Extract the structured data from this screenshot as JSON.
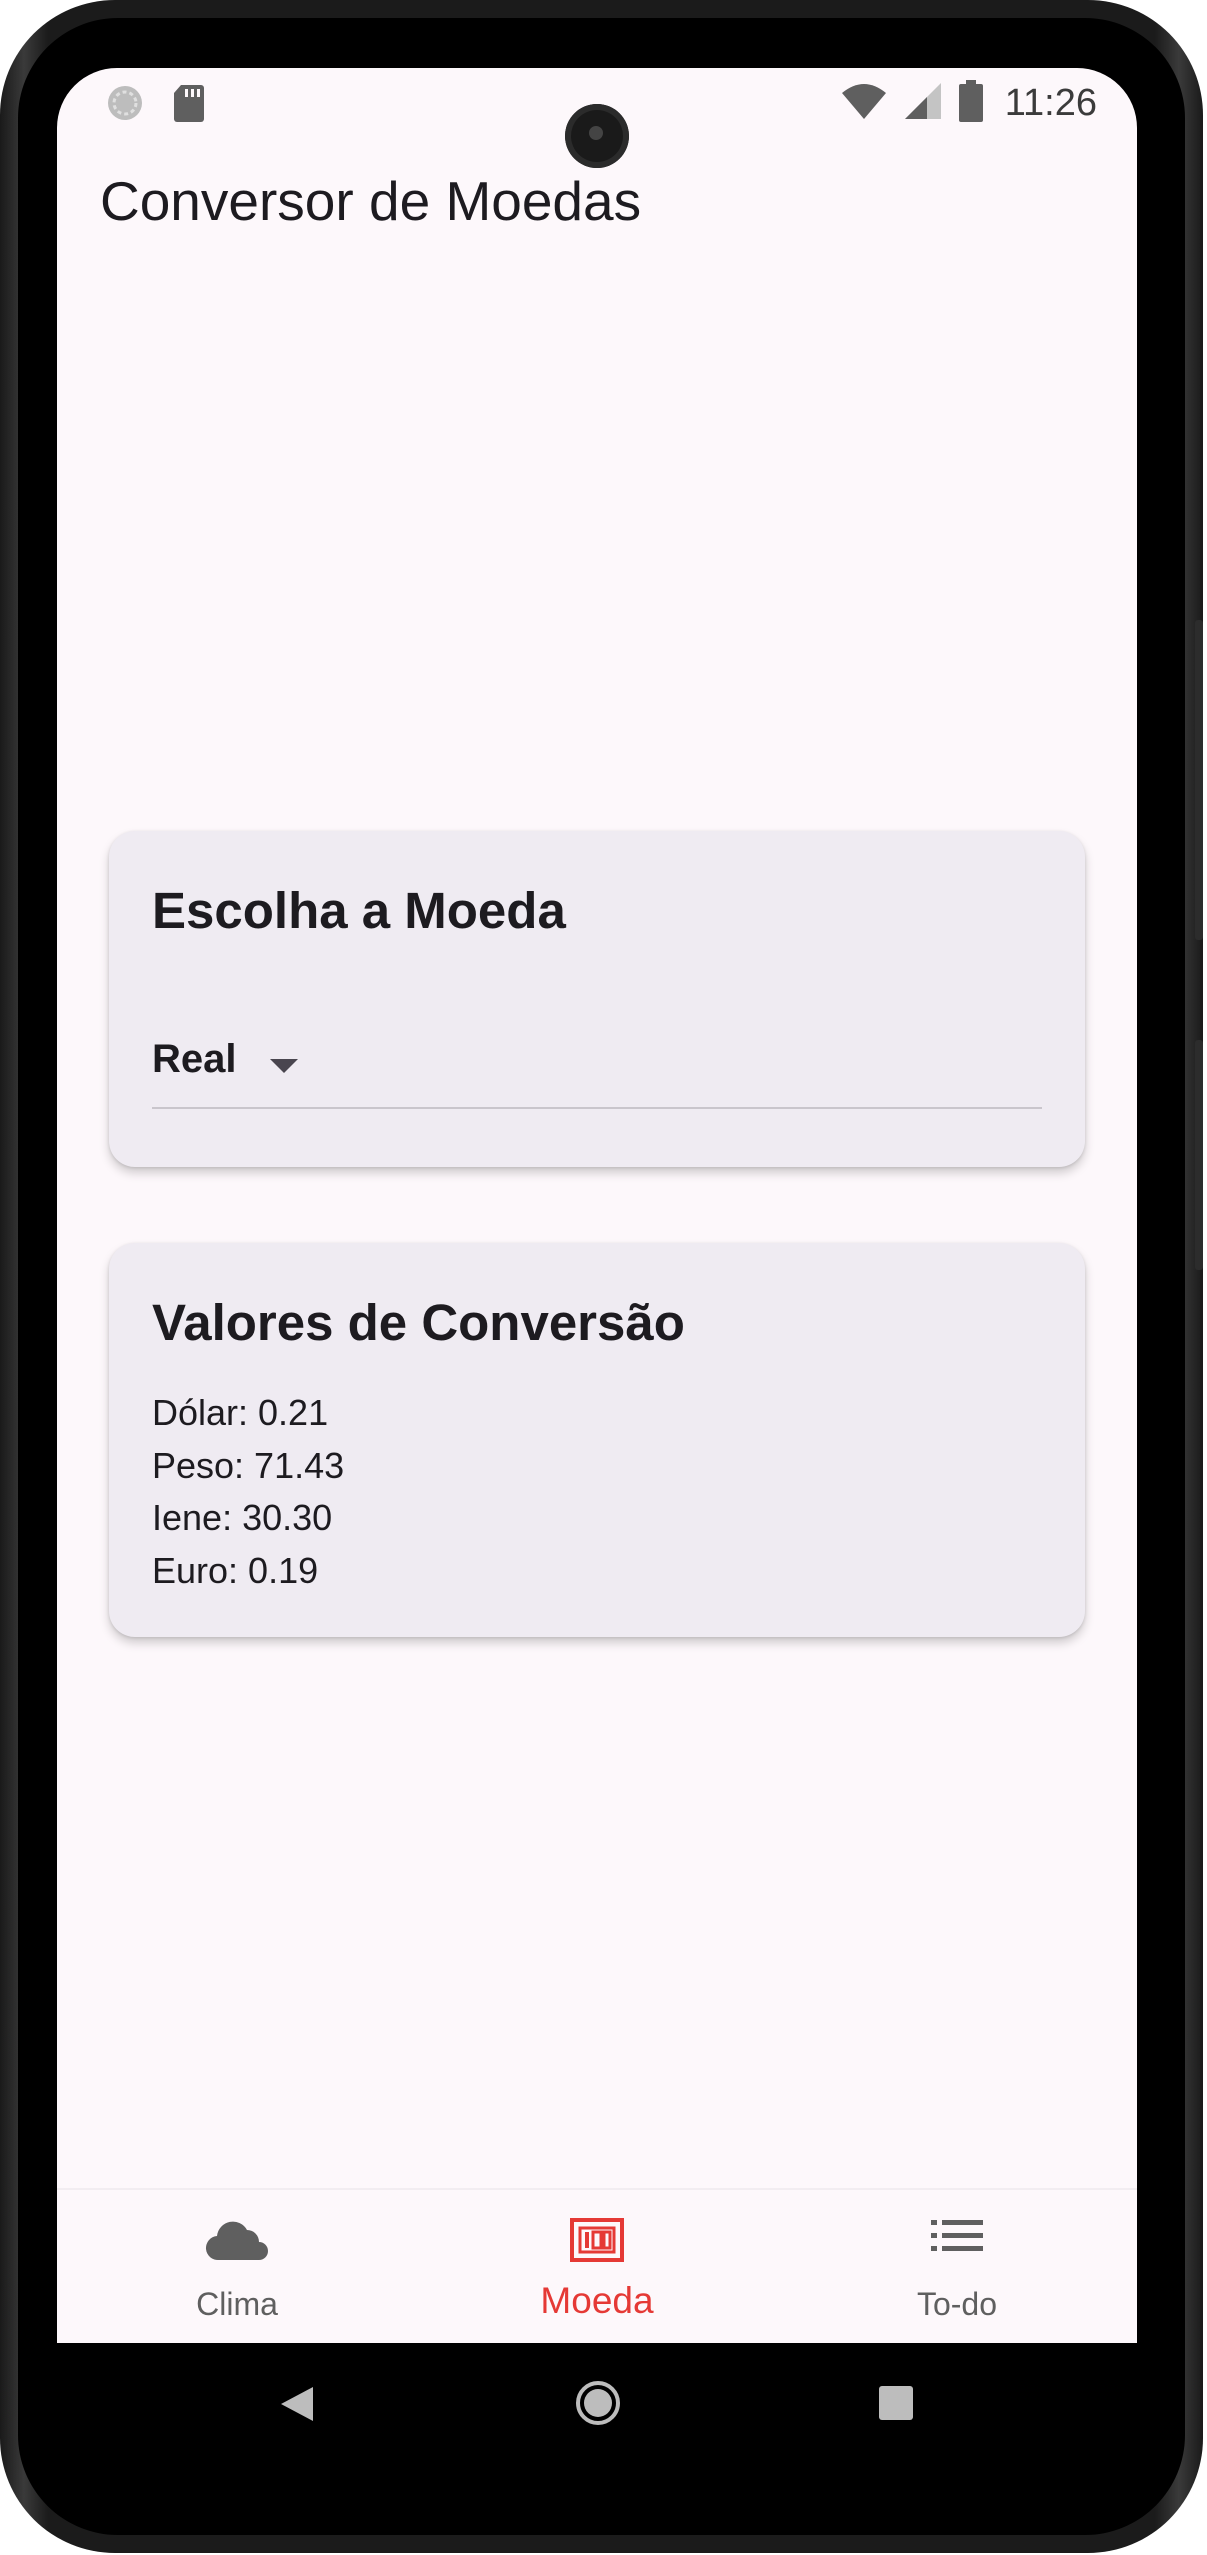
{
  "status_bar": {
    "time": "11:26",
    "left_icons": [
      "sync-icon",
      "sd-card-icon"
    ],
    "right_icons": [
      "wifi-icon",
      "signal-icon",
      "battery-icon"
    ]
  },
  "app_bar": {
    "title": "Conversor de Moedas"
  },
  "currency_card": {
    "title": "Escolha a Moeda",
    "selected_currency": "Real"
  },
  "conversion_card": {
    "title": "Valores de Conversão",
    "rates": [
      "Dólar: 0.21",
      "Peso: 71.43",
      "Iene: 30.30",
      "Euro: 0.19"
    ]
  },
  "bottom_nav": {
    "items": [
      {
        "label": "Clima",
        "icon": "cloud-icon",
        "active": false
      },
      {
        "label": "Moeda",
        "icon": "money-icon",
        "active": true
      },
      {
        "label": "To-do",
        "icon": "list-icon",
        "active": false
      }
    ],
    "active_color": "#e53935",
    "inactive_color": "#5f5f5f"
  },
  "system_nav": {
    "buttons": [
      "back-icon",
      "home-icon",
      "recents-icon"
    ]
  }
}
